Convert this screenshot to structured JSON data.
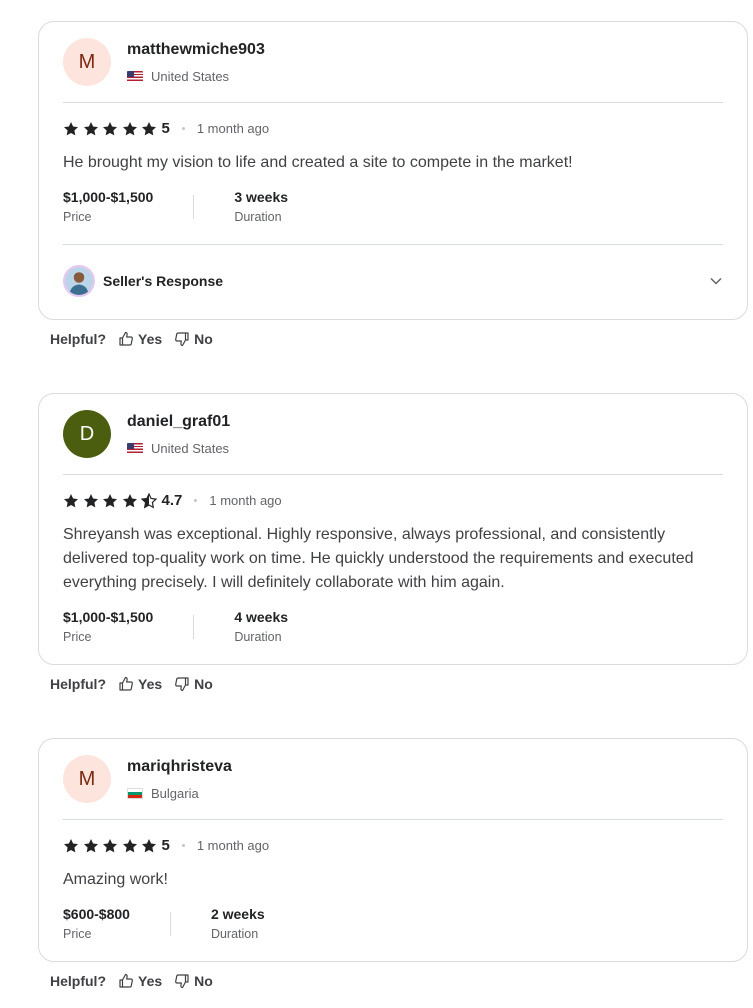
{
  "reviews": [
    {
      "initial": "M",
      "username": "matthewmiche903",
      "country": "United States",
      "rating": "5",
      "stars": 5,
      "time": "1 month ago",
      "text": "He brought my vision to life and created a site to compete in the market!",
      "price_value": "$1,000-$1,500",
      "price_label": "Price",
      "duration_value": "3 weeks",
      "duration_label": "Duration",
      "seller_response_label": "Seller's Response"
    },
    {
      "initial": "D",
      "username": "daniel_graf01",
      "country": "United States",
      "rating": "4.7",
      "stars": 4.5,
      "time": "1 month ago",
      "text": "Shreyansh was exceptional. Highly responsive, always professional, and consistently delivered top-quality work on time. He quickly understood the requirements and executed everything precisely. I will definitely collaborate with him again.",
      "price_value": "$1,000-$1,500",
      "price_label": "Price",
      "duration_value": "4 weeks",
      "duration_label": "Duration"
    },
    {
      "initial": "M",
      "username": "mariqhristeva",
      "country": "Bulgaria",
      "rating": "5",
      "stars": 5,
      "time": "1 month ago",
      "text": "Amazing work!",
      "price_value": "$600-$800",
      "price_label": "Price",
      "duration_value": "2 weeks",
      "duration_label": "Duration"
    }
  ],
  "helpful": {
    "label": "Helpful?",
    "yes": "Yes",
    "no": "No"
  },
  "colors": {
    "text": "#222325",
    "muted": "#62646a",
    "border": "#dadbdd",
    "avatar_light": "#fde5dd",
    "avatar_dark": "#4b5e10"
  }
}
